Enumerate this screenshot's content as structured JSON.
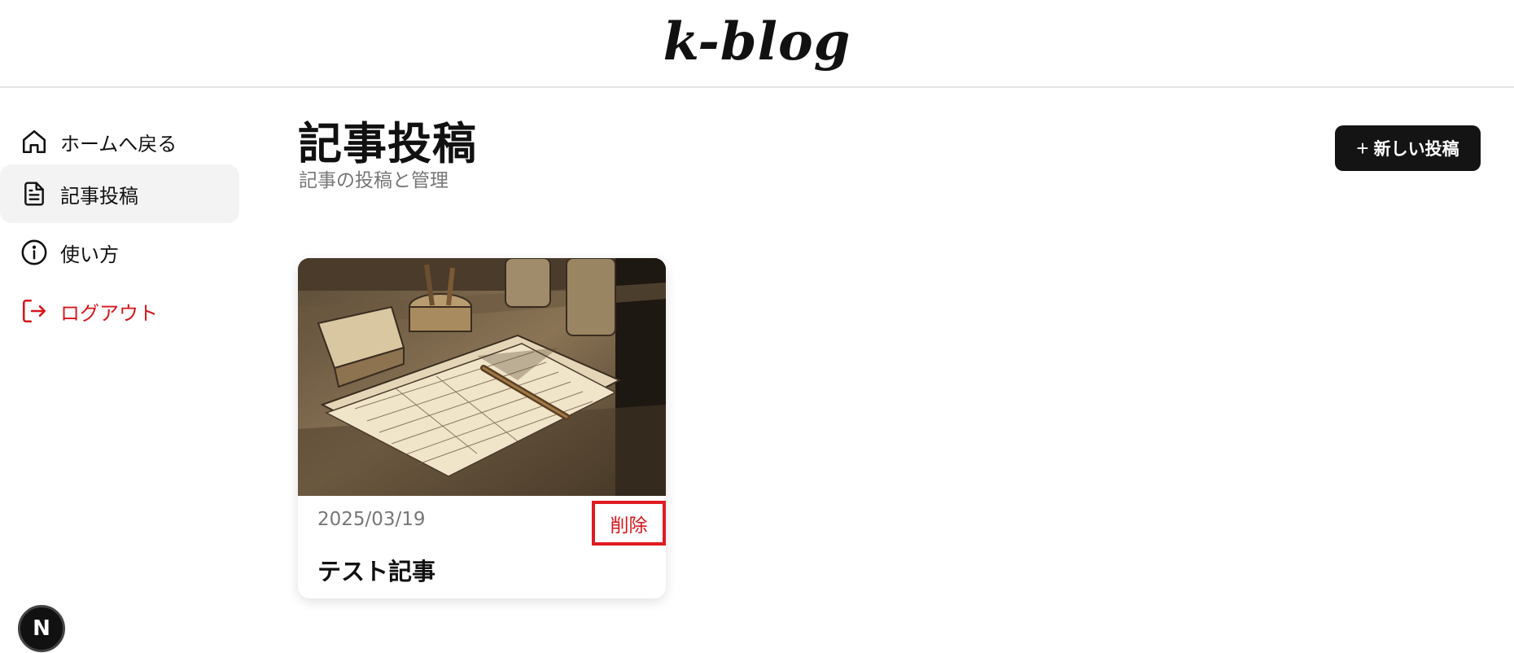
{
  "app": {
    "logo": "k-blog"
  },
  "sidebar": {
    "items": [
      {
        "label": "ホームへ戻る",
        "icon": "home-icon"
      },
      {
        "label": "記事投稿",
        "icon": "document-icon",
        "active": true
      },
      {
        "label": "使い方",
        "icon": "info-icon"
      },
      {
        "label": "ログアウト",
        "icon": "logout-icon",
        "color": "#d6161c"
      }
    ]
  },
  "main": {
    "title": "記事投稿",
    "subtitle": "記事の投稿と管理",
    "new_post_label": "新しい投稿"
  },
  "posts": [
    {
      "date": "2025/03/19",
      "title": "テスト記事",
      "delete_label": "削除",
      "image": "sketch-of-desk-with-papers-and-pen"
    }
  ],
  "badge": {
    "label": "N"
  },
  "colors": {
    "accent_dark": "#141414",
    "danger": "#d6161c",
    "muted_text": "#777777",
    "active_bg": "#f3f3f3"
  }
}
